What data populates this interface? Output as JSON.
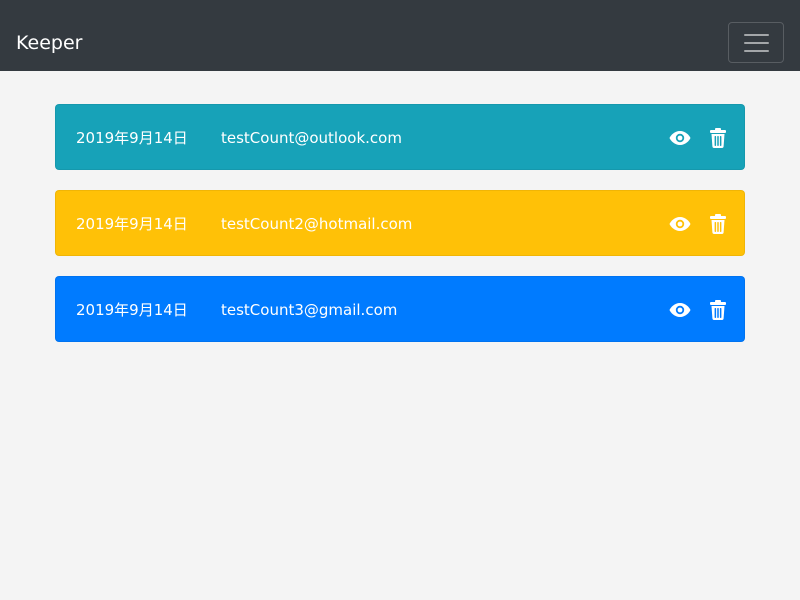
{
  "navbar": {
    "brand": "Keeper",
    "menu_icon": "hamburger-menu-icon",
    "background": "#343a40"
  },
  "accounts": [
    {
      "date": "2019年9月14日",
      "email": "testCount@outlook.com",
      "color": "#17a2b8",
      "view_icon": "eye-icon",
      "delete_icon": "trash-icon"
    },
    {
      "date": "2019年9月14日",
      "email": "testCount2@hotmail.com",
      "color": "#ffc107",
      "view_icon": "eye-icon",
      "delete_icon": "trash-icon"
    },
    {
      "date": "2019年9月14日",
      "email": "testCount3@gmail.com",
      "color": "#007bff",
      "view_icon": "eye-icon",
      "delete_icon": "trash-icon"
    }
  ],
  "page_background": "#f4f4f4"
}
